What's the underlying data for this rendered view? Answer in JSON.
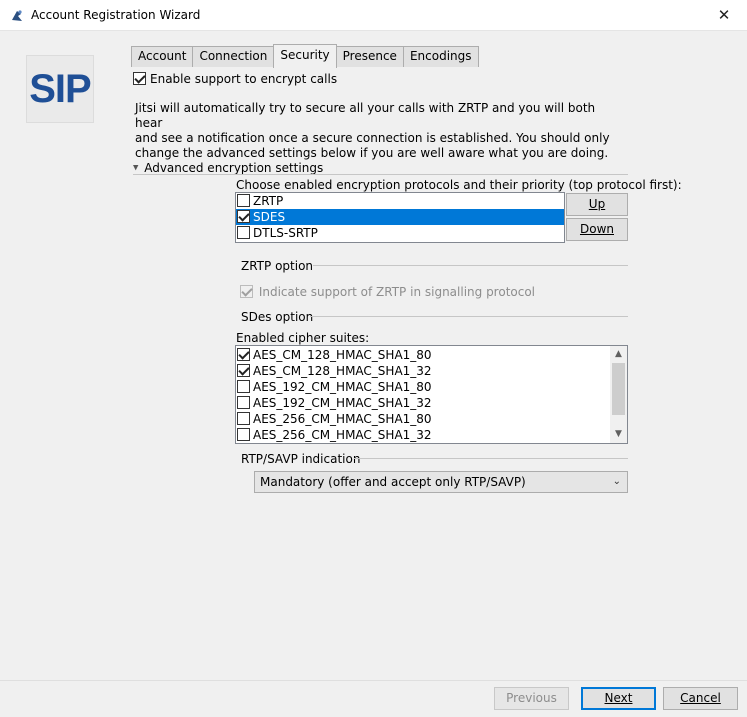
{
  "window": {
    "title": "Account Registration Wizard",
    "close_glyph": "✕"
  },
  "logo": {
    "text": "SIP"
  },
  "tabs": [
    {
      "label": "Account",
      "active": false
    },
    {
      "label": "Connection",
      "active": false
    },
    {
      "label": "Security",
      "active": true
    },
    {
      "label": "Presence",
      "active": false
    },
    {
      "label": "Encodings",
      "active": false
    }
  ],
  "security": {
    "enable_label": "Enable support to encrypt calls",
    "enable_checked": true,
    "description": [
      "Jitsi will automatically try to secure all your calls with ZRTP and you will both hear",
      "and see a notification once a secure connection is established. You should only",
      "change the advanced settings below if you are well aware what you are doing."
    ],
    "advanced_label": "Advanced encryption settings",
    "protocols_label": "Choose enabled encryption protocols and their priority (top protocol first):",
    "protocols": [
      {
        "name": "ZRTP",
        "checked": false,
        "selected": false
      },
      {
        "name": "SDES",
        "checked": true,
        "selected": true
      },
      {
        "name": "DTLS-SRTP",
        "checked": false,
        "selected": false
      }
    ],
    "up_label": "Up",
    "down_label": "Down",
    "zrtp_option_label": "ZRTP option",
    "zrtp_indicate_label": "Indicate support of ZRTP in signalling protocol",
    "sdes_option_label": "SDes option",
    "ciphers_label": "Enabled cipher suites:",
    "ciphers": [
      {
        "name": "AES_CM_128_HMAC_SHA1_80",
        "checked": true
      },
      {
        "name": "AES_CM_128_HMAC_SHA1_32",
        "checked": true
      },
      {
        "name": "AES_192_CM_HMAC_SHA1_80",
        "checked": false
      },
      {
        "name": "AES_192_CM_HMAC_SHA1_32",
        "checked": false
      },
      {
        "name": "AES_256_CM_HMAC_SHA1_80",
        "checked": false
      },
      {
        "name": "AES_256_CM_HMAC_SHA1_32",
        "checked": false
      }
    ],
    "rtp_label": "RTP/SAVP indication",
    "rtp_value": "Mandatory (offer and accept only RTP/SAVP)"
  },
  "footer": {
    "previous_label": "Previous",
    "next_label": "Next",
    "cancel_label": "Cancel"
  },
  "icons": {
    "app": "jitsi-app-icon",
    "expand": "triangle-down-icon",
    "dropdown": "chevron-down-icon"
  }
}
